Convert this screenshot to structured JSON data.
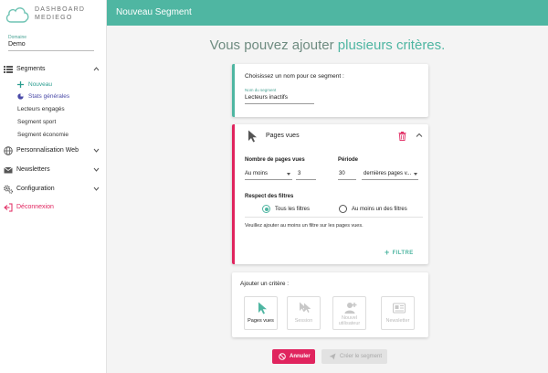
{
  "brand": {
    "line1": "DASHBOARD",
    "line2": "MEDIEGO"
  },
  "domain": {
    "label": "Domaine",
    "value": "Demo"
  },
  "sidebar": {
    "segments": "Segments",
    "sub": [
      "Nouveau",
      "Stats générales",
      "Lecteurs engagés",
      "Segment sport",
      "Segment économie"
    ],
    "perso": "Personnalisation Web",
    "newsletters": "Newsletters",
    "config": "Configuration",
    "logout": "Déconnexion"
  },
  "header": {
    "title": "Nouveau Segment"
  },
  "headline": {
    "pre": "Vous pouvez ajouter ",
    "highlight": "plusieurs critères."
  },
  "name_card": {
    "title": "Choisissez un nom pour ce segment :",
    "label": "Nom du segment",
    "value": "Lecteurs inactifs"
  },
  "criteria_card": {
    "title": "Pages vues",
    "pages_heading": "Nombre de pages vues",
    "operator": "Au moins",
    "count": "3",
    "period_heading": "Période",
    "period_value": "30",
    "period_unit": "dernières pages v...",
    "filters_heading": "Respect des filtres",
    "radio_all": "Tous les filtres",
    "radio_one": "Au moins un des filtres",
    "note": "Veuillez ajouter au moins un filtre sur les pages vues.",
    "filter_button": "FILTRE"
  },
  "add_card": {
    "title": "Ajouter un critère :",
    "tiles": [
      {
        "label": "Pages vues"
      },
      {
        "label": "Session"
      },
      {
        "label": "Nouvel utilisateur"
      },
      {
        "label": "Newsletter"
      }
    ]
  },
  "actions": {
    "cancel": "Annuler",
    "create": "Créer le segment"
  },
  "colors": {
    "accent": "#4fb6a2",
    "danger": "#e0245e",
    "disabled": "#bbbbbb"
  }
}
